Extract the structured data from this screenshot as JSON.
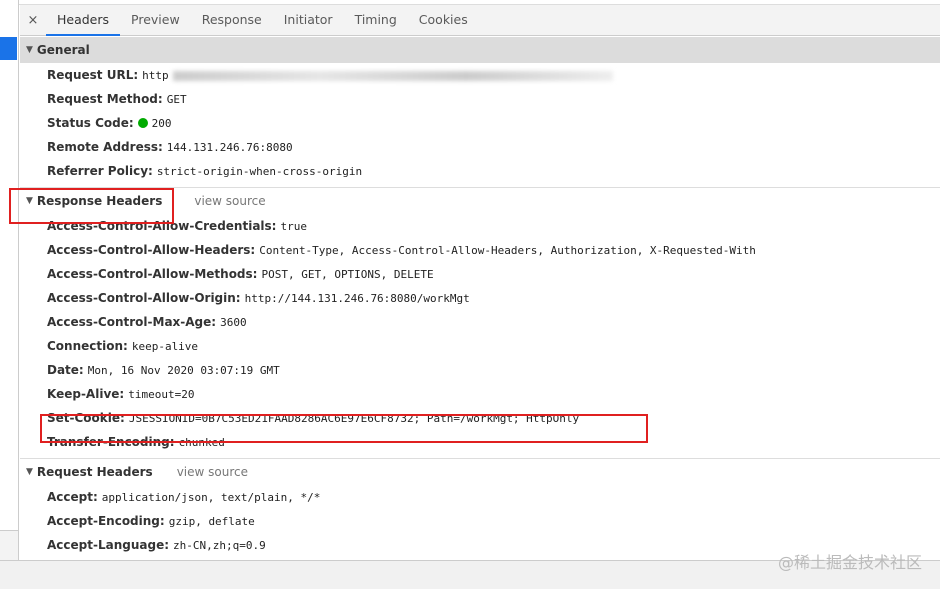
{
  "tabs": [
    "Headers",
    "Preview",
    "Response",
    "Initiator",
    "Timing",
    "Cookies"
  ],
  "close": "×",
  "general": {
    "title": "General",
    "rows": [
      {
        "k": "Request URL:",
        "v": "http"
      },
      {
        "k": "Request Method:",
        "v": "GET"
      },
      {
        "k": "Status Code:",
        "v": "200"
      },
      {
        "k": "Remote Address:",
        "v": "144.131.246.76:8080"
      },
      {
        "k": "Referrer Policy:",
        "v": "strict-origin-when-cross-origin"
      }
    ]
  },
  "response": {
    "title": "Response Headers",
    "view_source": "view source",
    "rows": [
      {
        "k": "Access-Control-Allow-Credentials:",
        "v": "true"
      },
      {
        "k": "Access-Control-Allow-Headers:",
        "v": "Content-Type, Access-Control-Allow-Headers, Authorization, X-Requested-With"
      },
      {
        "k": "Access-Control-Allow-Methods:",
        "v": "POST, GET, OPTIONS, DELETE"
      },
      {
        "k": "Access-Control-Allow-Origin:",
        "v": "http://144.131.246.76:8080/workMgt"
      },
      {
        "k": "Access-Control-Max-Age:",
        "v": "3600"
      },
      {
        "k": "Connection:",
        "v": "keep-alive"
      },
      {
        "k": "Date:",
        "v": "Mon, 16 Nov 2020 03:07:19 GMT"
      },
      {
        "k": "Keep-Alive:",
        "v": "timeout=20"
      },
      {
        "k": "Set-Cookie:",
        "v": "JSESSIONID=0B7C53ED21FAAD8286AC6E97E6CF8732; Path=/workMgt; HttpOnly"
      },
      {
        "k": "Transfer-Encoding:",
        "v": "chunked"
      }
    ]
  },
  "request": {
    "title": "Request Headers",
    "view_source": "view source",
    "rows": [
      {
        "k": "Accept:",
        "v": "application/json, text/plain, */*"
      },
      {
        "k": "Accept-Encoding:",
        "v": "gzip, deflate"
      },
      {
        "k": "Accept-Language:",
        "v": "zh-CN,zh;q=0.9"
      }
    ]
  },
  "watermark": "@稀土掘金技术社区"
}
